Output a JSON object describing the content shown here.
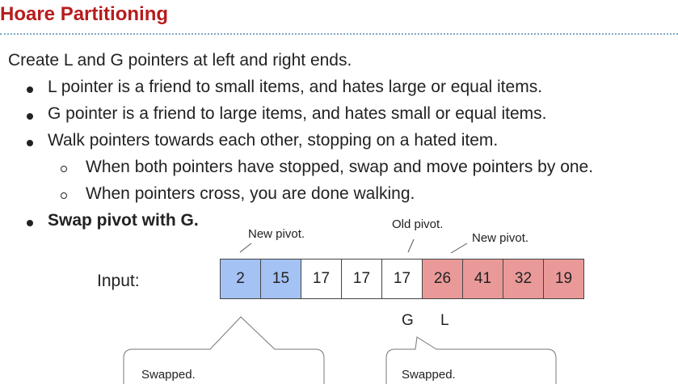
{
  "title": "Hoare Partitioning",
  "intro": "Create L and G pointers at left and right ends.",
  "bullets": [
    "L pointer is a friend to small items, and hates large or equal items.",
    "G pointer is a friend to large items, and hates small or equal items.",
    "Walk pointers towards each other, stopping on a hated item."
  ],
  "sub_bullets": [
    "When both pointers have stopped, swap and move pointers by one.",
    "When pointers cross, you are done walking."
  ],
  "final_bullet": "Swap pivot with G.",
  "annotations": {
    "new_pivot_left": "New pivot.",
    "old_pivot": "Old pivot.",
    "new_pivot_right": "New pivot."
  },
  "input_label": "Input:",
  "array": {
    "values": [
      "2",
      "15",
      "17",
      "17",
      "17",
      "26",
      "41",
      "32",
      "19"
    ],
    "colors": [
      "#a4c2f4",
      "#a4c2f4",
      "#ffffff",
      "#ffffff",
      "#ffffff",
      "#ea9999",
      "#ea9999",
      "#ea9999",
      "#ea9999"
    ]
  },
  "pointers": {
    "g": "G",
    "l": "L"
  },
  "callouts": {
    "left": "Swapped.",
    "right": "Swapped."
  },
  "colors": {
    "title": "#b71c1c",
    "small": "#a4c2f4",
    "large": "#ea9999",
    "divider": "#7fa9c4"
  }
}
